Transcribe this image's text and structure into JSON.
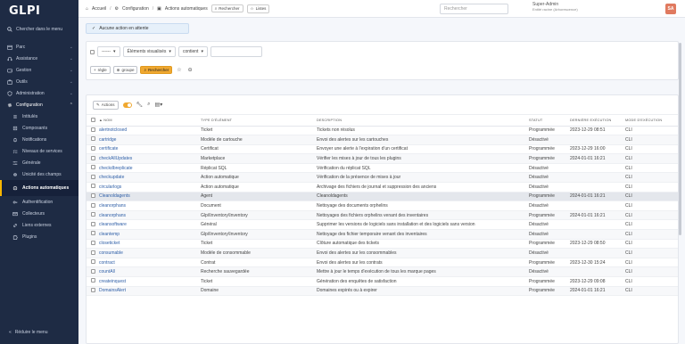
{
  "sidebar": {
    "logo": "GLPI",
    "search_label": "Chercher dans le menu",
    "menu": [
      {
        "label": "Parc",
        "icon": "box-icon"
      },
      {
        "label": "Assistance",
        "icon": "headset-icon"
      },
      {
        "label": "Gestion",
        "icon": "wallet-icon"
      },
      {
        "label": "Outils",
        "icon": "briefcase-icon"
      },
      {
        "label": "Administration",
        "icon": "shield-icon"
      },
      {
        "label": "Configuration",
        "icon": "gear-icon"
      }
    ],
    "submenu": [
      {
        "label": "Intitulés",
        "icon": "list-icon"
      },
      {
        "label": "Composants",
        "icon": "components-icon"
      },
      {
        "label": "Notifications",
        "icon": "bell-icon"
      },
      {
        "label": "Niveaux de services",
        "icon": "checklist-icon"
      },
      {
        "label": "Générale",
        "icon": "sliders-icon"
      },
      {
        "label": "Unicité des champs",
        "icon": "fingerprint-icon"
      },
      {
        "label": "Actions automatiques",
        "icon": "robot-icon"
      },
      {
        "label": "Authentification",
        "icon": "key-icon"
      },
      {
        "label": "Collecteurs",
        "icon": "mail-icon"
      },
      {
        "label": "Liens externes",
        "icon": "link-icon"
      },
      {
        "label": "Plugins",
        "icon": "puzzle-icon"
      }
    ],
    "collapse_label": "Réduire le menu"
  },
  "header": {
    "breadcrumbs": [
      "Accueil",
      "Configuration",
      "Actions automatiques"
    ],
    "search_button": "Rechercher",
    "lists_button": "Listes",
    "search_placeholder": "Rechercher",
    "user_name": "Super-Admin",
    "user_entity": "Entité racine (Arborescence)",
    "avatar_initials": "SA"
  },
  "pending": {
    "label": "Aucune action en attente"
  },
  "filter": {
    "field_placeholder": "------",
    "field_select": "Éléments visualisés",
    "operator": "contient",
    "value": "",
    "rule_btn": "règle",
    "group_btn": "groupe",
    "search_btn": "Rechercher"
  },
  "results": {
    "actions_btn": "Actions",
    "columns": [
      "NOM",
      "TYPE D'ÉLÉMENT",
      "DESCRIPTION",
      "STATUT",
      "DERNIÈRE EXÉCUTION",
      "MODE D'EXÉCUTION"
    ],
    "rows": [
      {
        "name": "alertnotclosed",
        "type": "Ticket",
        "desc": "Tickets non résolus",
        "status": "Programmée",
        "last": "2023-12-29 08:51",
        "mode": "CLI"
      },
      {
        "name": "cartridge",
        "type": "Modèle de cartouche",
        "desc": "Envoi des alertes sur les cartouches",
        "status": "Désactivé",
        "last": "",
        "mode": "CLI"
      },
      {
        "name": "certificate",
        "type": "Certificat",
        "desc": "Envoyer une alerte à l'expiration d'un certificat",
        "status": "Programmée",
        "last": "2023-12-29 16:00",
        "mode": "CLI"
      },
      {
        "name": "checkAllUpdates",
        "type": "Marketplace",
        "desc": "Vérifier les mises à jour de tous les plugins",
        "status": "Programmée",
        "last": "2024-01-01 16:21",
        "mode": "CLI"
      },
      {
        "name": "checkdbreplicate",
        "type": "Réplicat SQL",
        "desc": "Vérification du réplicat SQL",
        "status": "Désactivé",
        "last": "",
        "mode": "CLI"
      },
      {
        "name": "checkupdate",
        "type": "Action automatique",
        "desc": "Vérification de la présence de mises à jour",
        "status": "Désactivé",
        "last": "",
        "mode": "CLI"
      },
      {
        "name": "circularlogs",
        "type": "Action automatique",
        "desc": "Archivage des fichiers de journal et suppression des anciens",
        "status": "Désactivé",
        "last": "",
        "mode": "CLI"
      },
      {
        "name": "Cleanoldagents",
        "type": "Agent",
        "desc": "Cleanoldagents",
        "status": "Programmée",
        "last": "2024-01-01 16:21",
        "mode": "CLI"
      },
      {
        "name": "cleanorphans",
        "type": "Document",
        "desc": "Nettoyage des documents orphelins",
        "status": "Désactivé",
        "last": "",
        "mode": "CLI"
      },
      {
        "name": "cleanorphans",
        "type": "Glpi\\Inventory\\Inventory",
        "desc": "Nettoyages des fichiers orphelins venant des inventaires",
        "status": "Programmée",
        "last": "2024-01-01 16:21",
        "mode": "CLI"
      },
      {
        "name": "cleansoftware",
        "type": "Général",
        "desc": "Supprimer les versions de logiciels sans installation et des logiciels sans version",
        "status": "Désactivé",
        "last": "",
        "mode": "CLI"
      },
      {
        "name": "cleantemp",
        "type": "Glpi\\Inventory\\Inventory",
        "desc": "Nettoyage des fichier temporaire venant des inventaires",
        "status": "Désactivé",
        "last": "",
        "mode": "CLI"
      },
      {
        "name": "closeticket",
        "type": "Ticket",
        "desc": "Clôture automatique des tickets",
        "status": "Programmée",
        "last": "2023-12-29 08:50",
        "mode": "CLI"
      },
      {
        "name": "consumable",
        "type": "Modèle de consommable",
        "desc": "Envoi des alertes sur les consommables",
        "status": "Désactivé",
        "last": "",
        "mode": "CLI"
      },
      {
        "name": "contract",
        "type": "Contrat",
        "desc": "Envoi des alertes sur les contrats",
        "status": "Programmée",
        "last": "2023-12-30 15:24",
        "mode": "CLI"
      },
      {
        "name": "countAll",
        "type": "Recherche sauvegardée",
        "desc": "Mettre à jour le temps d'exécution de tous les marque pages",
        "status": "Désactivé",
        "last": "",
        "mode": "CLI"
      },
      {
        "name": "createinquest",
        "type": "Ticket",
        "desc": "Génération des enquêtes de satisfaction",
        "status": "Programmée",
        "last": "2023-12-29 09:08",
        "mode": "CLI"
      },
      {
        "name": "DomainsAlert",
        "type": "Domaine",
        "desc": "Domaines expirés ou à expirer",
        "status": "Programmée",
        "last": "2024-01-01 16:21",
        "mode": "CLI"
      }
    ]
  }
}
